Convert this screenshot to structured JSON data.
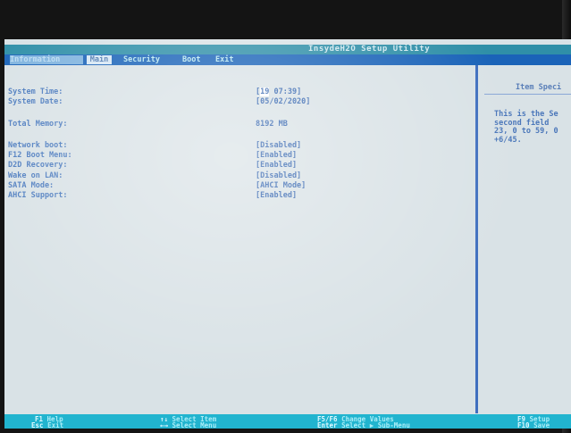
{
  "title": "InsydeH2O Setup Utility",
  "tabs": [
    {
      "label": "Information"
    },
    {
      "label": "Main",
      "active": true
    },
    {
      "label": "Security"
    },
    {
      "label": "Boot"
    },
    {
      "label": "Exit"
    }
  ],
  "rows": {
    "system_time": {
      "label": "System Time:",
      "value_prefix": "[",
      "value_hl": "19",
      "value_rest": " 07:39]"
    },
    "system_date": {
      "label": "System Date:",
      "value": "[05/02/2020]"
    },
    "total_memory": {
      "label": "Total Memory:",
      "value": "8192 MB"
    },
    "network_boot": {
      "label": "Network boot:",
      "value": "[Disabled]"
    },
    "f12_boot_menu": {
      "label": "F12 Boot Menu:",
      "value": "[Enabled]"
    },
    "d2d_recovery": {
      "label": "D2D Recovery:",
      "value": "[Enabled]"
    },
    "wake_on_lan": {
      "label": "Wake on LAN:",
      "value": "[Disabled]"
    },
    "sata_mode": {
      "label": "SATA Mode:",
      "value": "[AHCI Mode]"
    },
    "ahci_support": {
      "label": "AHCI Support:",
      "value": "[Enabled]"
    }
  },
  "help": {
    "title": "Item Speci",
    "text": "This is the Se\nsecond field\n23, 0 to 59, 0\n+6/45."
  },
  "footer": {
    "f1_key": "F1",
    "f1_label": "Help",
    "esc_key": "Esc",
    "esc_label": "Exit",
    "updown_key": "↑↓",
    "updown_label": "Select Item",
    "leftright_key": "←→",
    "leftright_label": "Select Menu",
    "f5f6_key": "F5/F6",
    "f5f6_label": "Change Values",
    "enter_key": "Enter",
    "enter_label": "Select ▶ Sub-Menu",
    "f9_key": "F9",
    "f9_label": "Setup",
    "f10_key": "F10",
    "f10_label": "Save"
  },
  "colors": {
    "title_bar": "#2f8fa8",
    "tab_bar": "#1a63b8",
    "screen_bg": "#d9e2e6",
    "footer": "#21b4cf",
    "label_text": "#4d7cbf",
    "value_text": "#3566b0"
  }
}
